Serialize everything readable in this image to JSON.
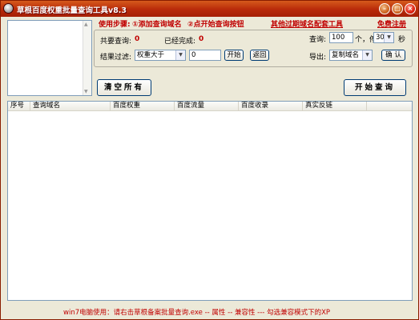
{
  "window": {
    "title": "草根百度权重批量查询工具v8.3",
    "min_glyph": "–",
    "max_glyph": "□",
    "close_glyph": "×"
  },
  "steps": {
    "label": "使用步骤:",
    "step1": "①添加查询域名",
    "step2": "②点开始查询按钮"
  },
  "links": {
    "expired": "其他过期域名配套工具",
    "register": "免费注册"
  },
  "stats": {
    "total_label": "共要查询:",
    "total_value": "0",
    "done_label": "已经完成:",
    "done_value": "0"
  },
  "query": {
    "label": "查询:",
    "count": "100",
    "unit": "个，停",
    "seconds": "30",
    "seconds_unit": "秒"
  },
  "filter": {
    "label": "结果过滤:",
    "selected": "权重大于",
    "value": "0",
    "filter_button": "开始",
    "back_button": "返回"
  },
  "export": {
    "label": "导出:",
    "selected": "复制域名",
    "confirm_button": "确 认"
  },
  "buttons": {
    "clear_all": "清空所有",
    "start_query": "开始查询"
  },
  "table": {
    "columns": [
      "序号",
      "查询域名",
      "百度权重",
      "百度流量",
      "百度收录",
      "真实反链"
    ]
  },
  "footer": {
    "text": "win7电脑使用：请右击草根备案批量查询.exe -- 属性 -- 兼容性 --- 勾选兼容模式下的XP"
  },
  "colors": {
    "titlebar": "#b82a0a",
    "accent_red": "#c00000",
    "background": "#ece9d8"
  }
}
